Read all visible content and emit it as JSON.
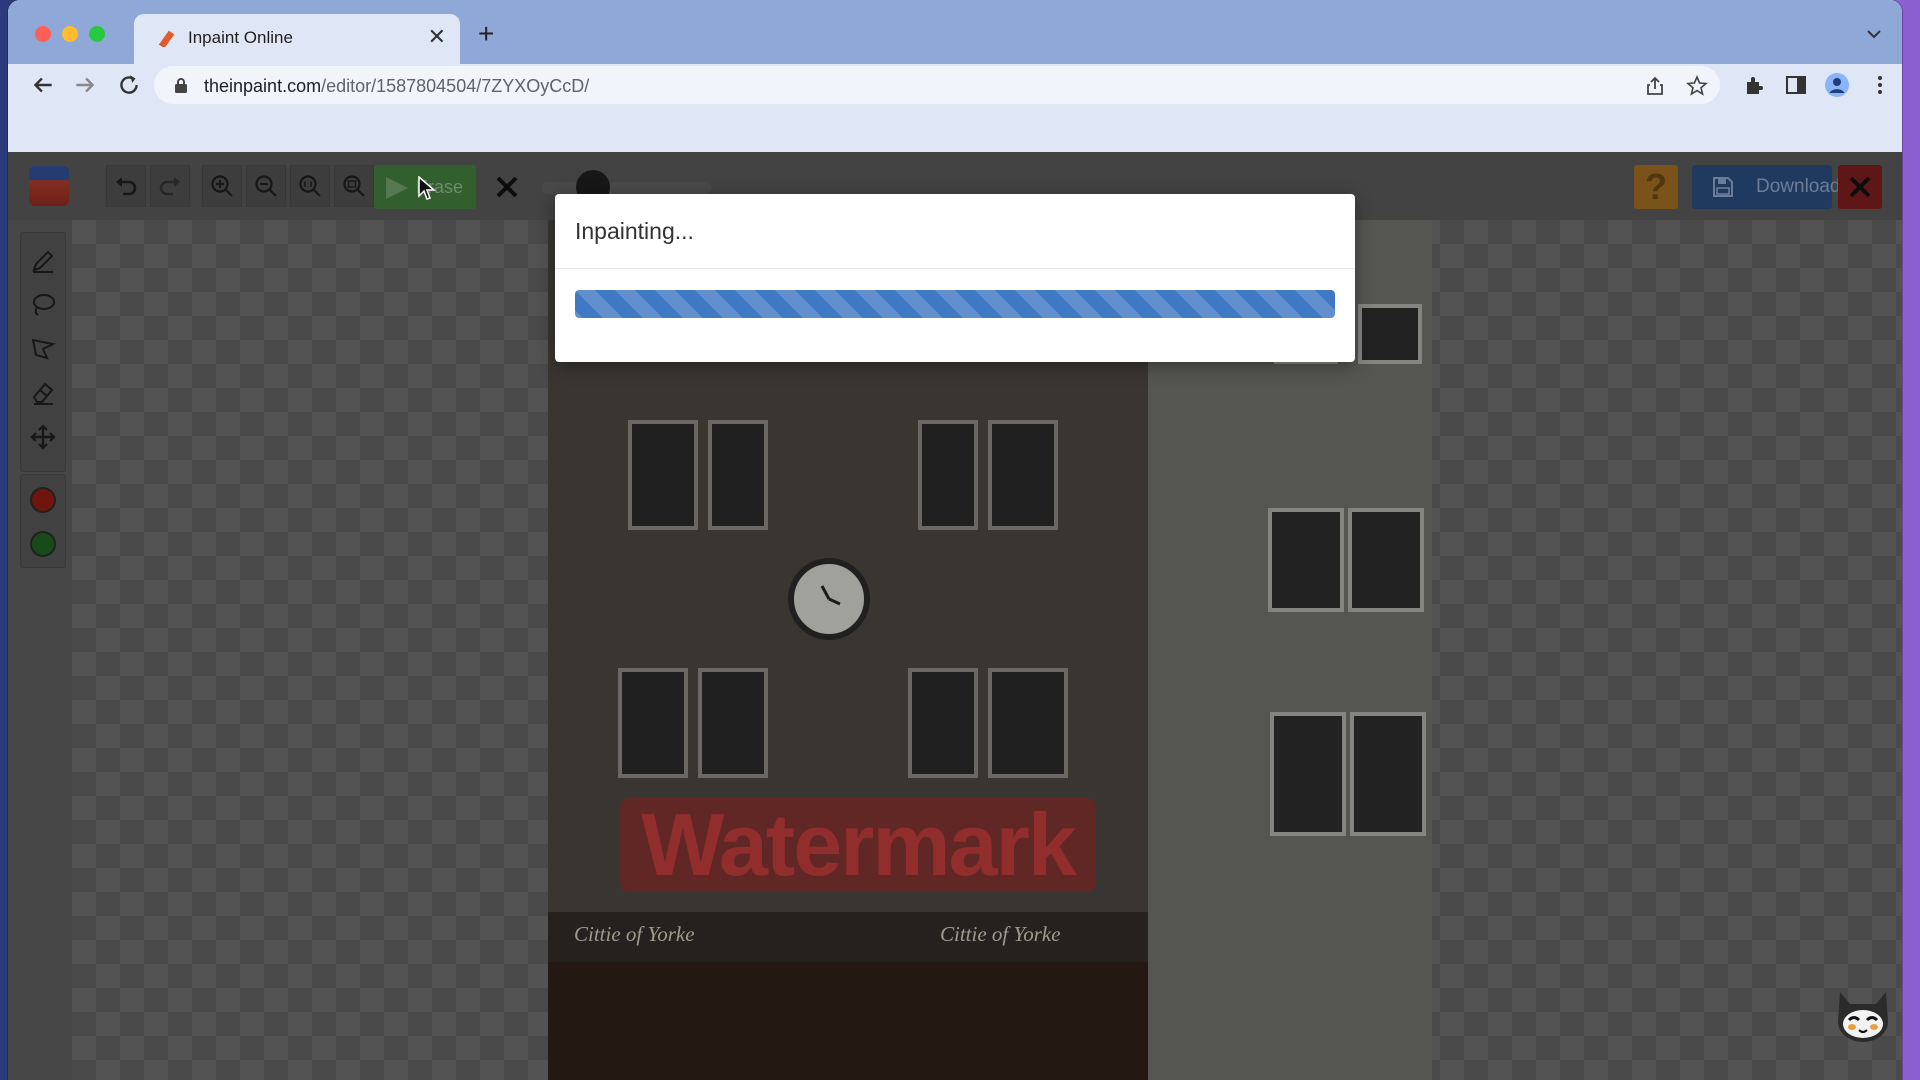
{
  "browser": {
    "tab_title": "Inpaint Online",
    "url_host": "theinpaint.com",
    "url_path": "/editor/1587804504/7ZYXOyCcD/"
  },
  "app": {
    "toolbar": {
      "erase_label": "Erase",
      "download_label": "Download",
      "help_label": "?"
    },
    "colors": {
      "accent_red": "#b3261e",
      "accent_green": "#2e7d32",
      "download_blue": "#2f64b4",
      "erase_green": "#4caf50"
    }
  },
  "canvas": {
    "watermark_text": "Watermark",
    "sign_left": "Cittie of Yorke",
    "sign_right": "Cittie of Yorke"
  },
  "modal": {
    "title": "Inpainting...",
    "progress": 1.0
  }
}
